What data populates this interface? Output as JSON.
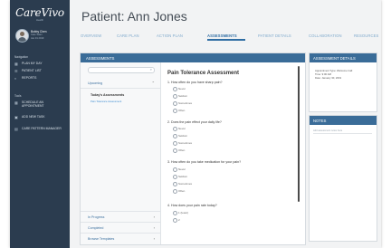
{
  "brand": {
    "logo": "CareVivo",
    "tagline": "Health"
  },
  "user": {
    "name": "Bobby Chen",
    "role": "Care Team",
    "date": "Jan 01 2019"
  },
  "sidebar": {
    "navigation_label": "Navigation",
    "nav": [
      {
        "icon": "calendar-icon",
        "label": "Plan my day"
      },
      {
        "icon": "list-icon",
        "label": "Patient List"
      },
      {
        "icon": "reports-icon",
        "label": "Reports"
      }
    ],
    "tools_label": "Tools",
    "tools": [
      {
        "icon": "calendar-icon",
        "label": "Schedule an appointment"
      },
      {
        "icon": "add-task-icon",
        "label": "Add New Task"
      },
      {
        "icon": "manager-icon",
        "label": "Care Pattern Manager"
      }
    ]
  },
  "header": {
    "title": "Patient: Ann Jones"
  },
  "tabs": [
    {
      "label": "Overview"
    },
    {
      "label": "Care Plan"
    },
    {
      "label": "Action Plan"
    },
    {
      "label": "Assessments",
      "active": true
    },
    {
      "label": "Patient Details"
    },
    {
      "label": "Collaboration"
    },
    {
      "label": "Resources"
    }
  ],
  "assessments": {
    "header": "Assessments",
    "search_placeholder": "Search",
    "upcoming": "Upcoming",
    "todays_heading": "Today's Assessments",
    "todays_link": "Pain Tolerance Assessment",
    "in_progress": "In Progress",
    "completed": "Completed",
    "browse": "Browse Templates",
    "form": {
      "title": "Pain Tolerance Assessment",
      "questions": [
        {
          "text": "1. How often do you have sharp pain?",
          "options": [
            "Never",
            "Seldom",
            "Sometimes",
            "Often"
          ]
        },
        {
          "text": "2. Does the pain effect your daily life?",
          "options": [
            "Never",
            "Seldom",
            "Sometimes",
            "Often"
          ]
        },
        {
          "text": "3. How often do you take medication for your pain?",
          "options": [
            "Never",
            "Seldom",
            "Sometimes",
            "Often"
          ]
        },
        {
          "text": "4. How does your pain rate today?",
          "options": [
            "1 (least)",
            "2"
          ]
        }
      ]
    }
  },
  "details": {
    "header": "Assessment Details",
    "lines": [
      "Appointment Type: Welcome Call",
      "Time: 9:00 AM",
      "Date: January 30, 2019"
    ]
  },
  "notes": {
    "header": "Notes",
    "placeholder": "Add assessment notes here"
  },
  "colors": {
    "sidebar": "#2b3c4f",
    "accent": "#3a6c98",
    "tab_active": "#2f6da3",
    "link": "#3b8ad0"
  }
}
